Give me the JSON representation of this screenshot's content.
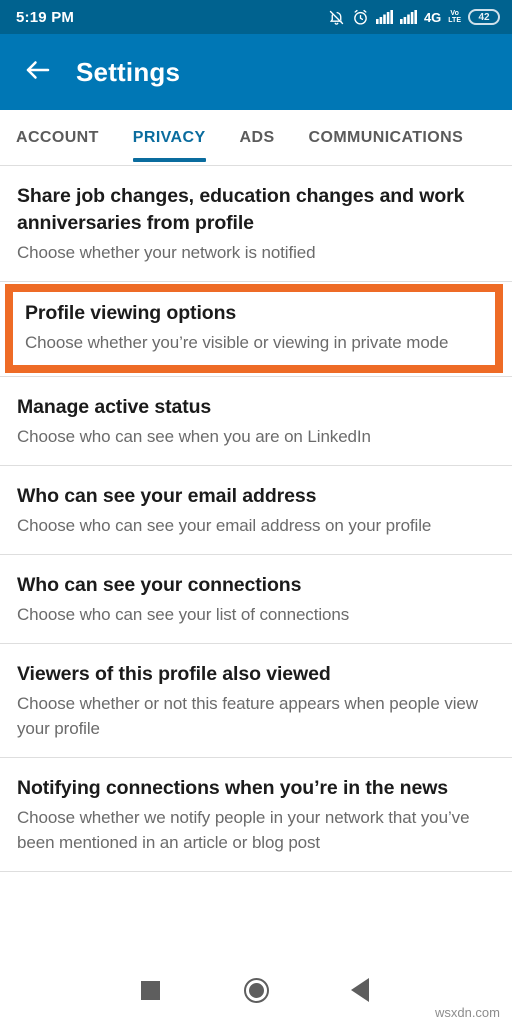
{
  "status_bar": {
    "time": "5:19 PM",
    "icons": [
      "bell-muted-icon",
      "alarm-icon",
      "signal-1-icon",
      "signal-2-icon"
    ],
    "network_label": "4G",
    "volte_top": "Vo",
    "volte_bottom": "LTE",
    "battery_level": "42",
    "background_color": "#00628f"
  },
  "app_bar": {
    "back_icon": "arrow-left-icon",
    "title": "Settings",
    "background_color": "#0077b5"
  },
  "tabs": {
    "active_index": 1,
    "accent_color": "#0a6c9e",
    "items": [
      {
        "label": "ACCOUNT"
      },
      {
        "label": "PRIVACY"
      },
      {
        "label": "ADS"
      },
      {
        "label": "COMMUNICATIONS"
      }
    ]
  },
  "highlight": {
    "color": "#ee6b26",
    "target_index": 1
  },
  "settings_list": [
    {
      "title": "Share job changes, education changes and work anniversaries from profile",
      "subtitle": "Choose whether your network is notified",
      "highlighted": false
    },
    {
      "title": "Profile viewing options",
      "subtitle": "Choose whether you’re visible or viewing in private mode",
      "highlighted": true
    },
    {
      "title": "Manage active status",
      "subtitle": "Choose who can see when you are on LinkedIn",
      "highlighted": false
    },
    {
      "title": "Who can see your email address",
      "subtitle": "Choose who can see your email address on your profile",
      "highlighted": false
    },
    {
      "title": "Who can see your connections",
      "subtitle": "Choose who can see your list of connections",
      "highlighted": false
    },
    {
      "title": "Viewers of this profile also viewed",
      "subtitle": "Choose whether or not this feature appears when people view your profile",
      "highlighted": false
    },
    {
      "title": "Notifying connections when you’re in the news",
      "subtitle": "Choose whether we notify people in your network that you’ve been mentioned in an article or blog post",
      "highlighted": false
    }
  ],
  "nav_bar": {
    "recents": "square-icon",
    "home": "circle-icon",
    "back": "triangle-back-icon"
  },
  "watermark": {
    "text": "wsxdn.com"
  }
}
